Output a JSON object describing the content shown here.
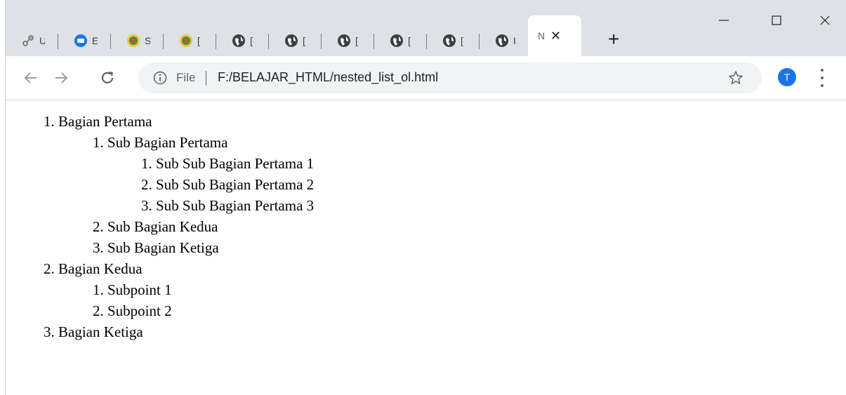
{
  "tabs": [
    {
      "title": "U",
      "icon": "link-icon"
    },
    {
      "title": "E",
      "icon": "mail-icon"
    },
    {
      "title": "S",
      "icon": "seal-icon"
    },
    {
      "title": "[",
      "icon": "seal-icon"
    },
    {
      "title": "[",
      "icon": "globe-icon"
    },
    {
      "title": "[",
      "icon": "globe-icon"
    },
    {
      "title": "[",
      "icon": "globe-icon"
    },
    {
      "title": "[",
      "icon": "globe-icon"
    },
    {
      "title": "[",
      "icon": "globe-icon"
    },
    {
      "title": "I",
      "icon": "globe-icon"
    }
  ],
  "active_tab": {
    "title": "N",
    "close": "✕"
  },
  "new_tab": "+",
  "window": {
    "minimize": "—",
    "maximize": "☐",
    "close": "✕"
  },
  "address": {
    "scheme_label": "File",
    "url": "F:/BELAJAR_HTML/nested_list_ol.html"
  },
  "profile": {
    "initial": "T"
  },
  "page": {
    "items": [
      {
        "num": "1.",
        "text": "Bagian Pertama"
      },
      {
        "num": "1.",
        "text": "Sub Bagian Pertama"
      },
      {
        "num": "1.",
        "text": "Sub Sub Bagian Pertama 1"
      },
      {
        "num": "2.",
        "text": "Sub Sub Bagian Pertama 2"
      },
      {
        "num": "3.",
        "text": "Sub Sub Bagian Pertama 3"
      },
      {
        "num": "2.",
        "text": "Sub Bagian Kedua"
      },
      {
        "num": "3.",
        "text": "Sub Bagian Ketiga"
      },
      {
        "num": "2.",
        "text": "Bagian Kedua"
      },
      {
        "num": "1.",
        "text": "Subpoint 1"
      },
      {
        "num": "2.",
        "text": "Subpoint 2"
      },
      {
        "num": "3.",
        "text": "Bagian Ketiga"
      }
    ]
  }
}
